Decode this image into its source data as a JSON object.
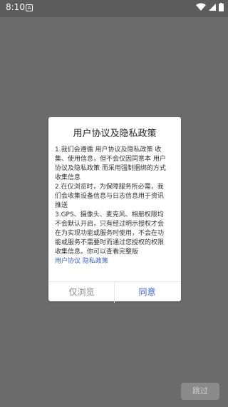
{
  "status_bar": {
    "time": "8:10",
    "app_icon": "A"
  },
  "dialog": {
    "title": "用户协议及隐私政策",
    "body_lines": [
      "1.我们会遵循 用户协议及隐私政策 收",
      "集、使用信息，但不会仅因同意本 用户",
      "协议及隐私政策 而采用强制捆绑的方式",
      "收集信息",
      "2.在仅浏览时，为保障服务所必需，我",
      "们会收集设备信息与日志信息用于资讯",
      "推送",
      "3.GPS、摄像头、麦克风、相册权限均",
      "不会默认开启，只有经过明示授权才会",
      "在为实现功能或服务时使用，不会在功",
      "能或服务不需要时而通过您授权的权限",
      "收集信息。你可以查看完整版"
    ],
    "link_user_agreement": "用户协议",
    "link_privacy_policy": "隐私政策",
    "browse_only_label": "仅浏览",
    "agree_label": "同意"
  },
  "skip_label": "跳过",
  "colors": {
    "link": "#3b63c4",
    "overlay": "#6b6b6b"
  }
}
